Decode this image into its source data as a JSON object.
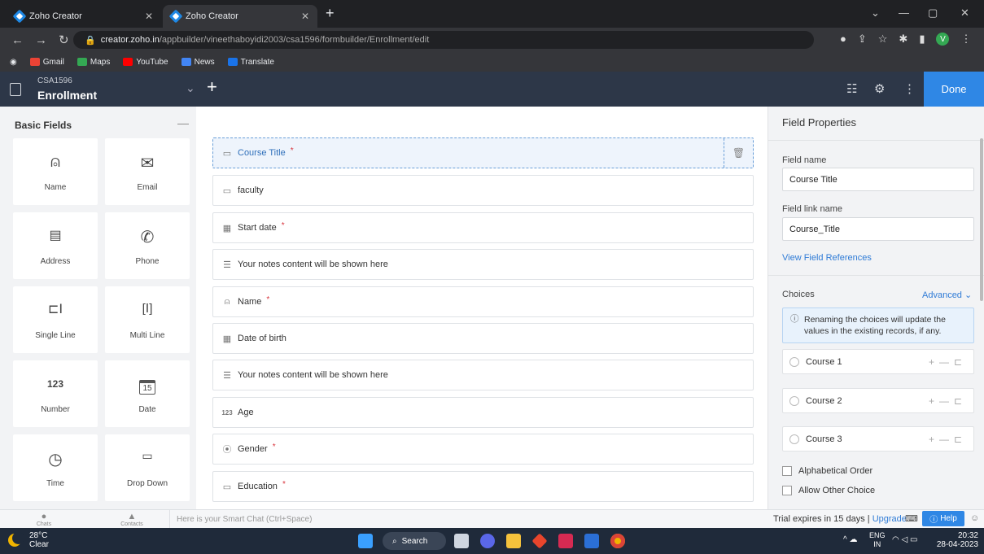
{
  "browser": {
    "tabs": [
      {
        "title": "Zoho Creator"
      },
      {
        "title": "Zoho Creator"
      }
    ],
    "url_host": "creator.zoho.in",
    "url_path": "/appbuilder/vineethaboyidi2003/csa1596/formbuilder/Enrollment/edit",
    "bookmarks": [
      "Gmail",
      "Maps",
      "YouTube",
      "News",
      "Translate"
    ],
    "profile_initial": "V"
  },
  "app_header": {
    "app_name": "CSA1596",
    "form_name": "Enrollment",
    "done_label": "Done"
  },
  "basic_fields": {
    "title": "Basic Fields",
    "items": [
      {
        "label": "Name",
        "icon": "person-icon"
      },
      {
        "label": "Email",
        "icon": "envelope-icon"
      },
      {
        "label": "Address",
        "icon": "address-card-icon"
      },
      {
        "label": "Phone",
        "icon": "phone-icon"
      },
      {
        "label": "Single Line",
        "icon": "single-line-icon"
      },
      {
        "label": "Multi Line",
        "icon": "multi-line-icon"
      },
      {
        "label": "Number",
        "icon_text": "123"
      },
      {
        "label": "Date",
        "icon_text": "15"
      },
      {
        "label": "Time",
        "icon": "clock-icon"
      },
      {
        "label": "Drop Down",
        "icon": "dropdown-icon"
      }
    ]
  },
  "form_fields": [
    {
      "label": "Course Title",
      "required": true,
      "icon": "dropdown-icon",
      "selected": true
    },
    {
      "label": "faculty",
      "required": false,
      "icon": "dropdown-icon"
    },
    {
      "label": "Start date",
      "required": true,
      "icon": "calendar-icon"
    },
    {
      "label": "Your notes content will be shown here",
      "required": false,
      "icon": "notes-icon"
    },
    {
      "label": "Name",
      "required": true,
      "icon": "person-icon"
    },
    {
      "label": "Date of birth",
      "required": false,
      "icon": "calendar-icon"
    },
    {
      "label": "Your notes content will be shown here",
      "required": false,
      "icon": "notes-icon"
    },
    {
      "label": "Age",
      "required": false,
      "icon_text": "123"
    },
    {
      "label": "Gender",
      "required": true,
      "icon": "radio-icon"
    },
    {
      "label": "Education",
      "required": true,
      "icon": "dropdown-icon"
    }
  ],
  "properties": {
    "title": "Field Properties",
    "field_name_label": "Field name",
    "field_name_value": "Course Title",
    "link_name_label": "Field link name",
    "link_name_value": "Course_Title",
    "view_refs": "View Field References",
    "choices_label": "Choices",
    "advanced": "Advanced",
    "notice": "Renaming the choices will update the values in the existing records, if any.",
    "choices": [
      "Course 1",
      "Course 2",
      "Course 3"
    ],
    "alphabetical": "Alphabetical Order",
    "allow_other": "Allow Other Choice"
  },
  "chat_bar": {
    "chats": "Chats",
    "contacts": "Contacts",
    "smart_chat": "Here is your Smart Chat (Ctrl+Space)",
    "trial_text": "Trial expires in 15 days |",
    "upgrade": "Upgrade",
    "help": "Help"
  },
  "taskbar": {
    "temp": "28°C",
    "weather": "Clear",
    "search": "Search",
    "lang": "ENG",
    "region": "IN",
    "time": "20:32",
    "date": "28-04-2023"
  }
}
